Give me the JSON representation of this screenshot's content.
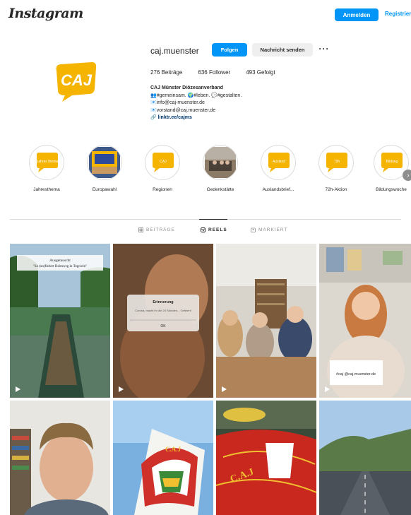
{
  "topbar": {
    "logo": "Instagram",
    "login_label": "Anmelden",
    "register_label": "Registrieren"
  },
  "profile": {
    "username": "caj.muenster",
    "follow_label": "Folgen",
    "message_label": "Nachricht senden",
    "more_label": "···",
    "avatar_text": "CAJ",
    "stats": {
      "posts": "276 Beiträge",
      "followers": "636 Follower",
      "following": "493 Gefolgt"
    },
    "bio": {
      "name": "CAJ Münster Diözesanverband",
      "line1": "👥#gemeinsam. 🌍#leben. 💬#gestalten.",
      "line2": "📧info@caj-muenster.de",
      "line3": "📧vorstand@caj.muenster.de",
      "link": "🔗 linktr.ee/cajms"
    }
  },
  "highlights": [
    {
      "label": "Jahresthema",
      "type": "logo",
      "icon_text": "Jahres thema"
    },
    {
      "label": "Europawahl",
      "type": "photo",
      "icon_text": ""
    },
    {
      "label": "Regionen",
      "type": "logo",
      "icon_text": "CAJ"
    },
    {
      "label": "Gedenkstätte",
      "type": "photo",
      "icon_text": ""
    },
    {
      "label": "Auslandsbrief...",
      "type": "logo",
      "icon_text": "Ausland"
    },
    {
      "label": "72h-Aktion",
      "type": "logo",
      "icon_text": "72h"
    },
    {
      "label": "Bildungswoche",
      "type": "logo",
      "icon_text": "Bildung"
    }
  ],
  "tabs": [
    {
      "label": "BEITRÄGE",
      "icon": "grid-icon"
    },
    {
      "label": "REELS",
      "icon": "reels-icon"
    },
    {
      "label": "MARKIERT",
      "icon": "tagged-icon"
    }
  ],
  "posts": [
    {
      "overlay_title": "Ausgetauscht",
      "overlay_sub": "\"So (un)fiebert Heimweg in Togo/ein\"",
      "reel": true
    },
    {
      "overlay_title": "Erinnerung",
      "overlay_sub": "Corona, macht ihr die 24 Stunden... Gefeiert!",
      "overlay_button": "OK",
      "reel": true
    },
    {
      "overlay_title": "",
      "reel": true
    },
    {
      "sign_text": "#caj @caj.muenster.de",
      "reel": true
    },
    {
      "reel": false
    },
    {
      "flag_text": "C.A.J",
      "reel": false
    },
    {
      "flag_text": "C.A.J",
      "reel": false
    },
    {
      "reel": false
    }
  ],
  "colors": {
    "brand_yellow": "#f5b400",
    "instagram_blue": "#0095f6"
  }
}
